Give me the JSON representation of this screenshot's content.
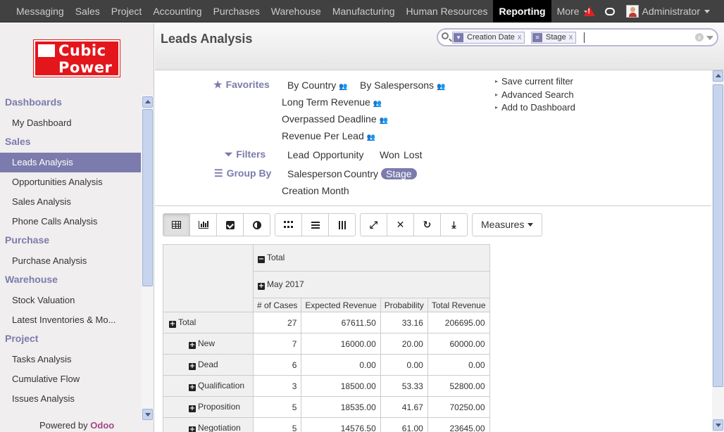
{
  "topbar": {
    "menu": [
      "Messaging",
      "Sales",
      "Project",
      "Accounting",
      "Purchases",
      "Warehouse",
      "Manufacturing",
      "Human Resources",
      "Reporting",
      "More"
    ],
    "active": "Reporting",
    "user": "Administrator"
  },
  "logo": {
    "line1": "Cubic",
    "line2": "Power"
  },
  "sidebar": {
    "sections": [
      {
        "title": "Dashboards",
        "items": [
          "My Dashboard"
        ]
      },
      {
        "title": "Sales",
        "items": [
          "Leads Analysis",
          "Opportunities Analysis",
          "Sales Analysis",
          "Phone Calls Analysis"
        ]
      },
      {
        "title": "Purchase",
        "items": [
          "Purchase Analysis"
        ]
      },
      {
        "title": "Warehouse",
        "items": [
          "Stock Valuation",
          "Latest Inventories & Mo..."
        ]
      },
      {
        "title": "Project",
        "items": [
          "Tasks Analysis",
          "Cumulative Flow",
          "Issues Analysis"
        ]
      }
    ],
    "active_item": "Leads Analysis",
    "powered_by": "Powered by",
    "powered_brand": "Odoo"
  },
  "header": {
    "title": "Leads Analysis"
  },
  "search": {
    "facets": [
      {
        "icon": "filter-icon",
        "label": "Creation Date"
      },
      {
        "icon": "group-icon",
        "label": "Stage"
      }
    ],
    "remove": "x",
    "clear": "x"
  },
  "drawer": {
    "favorites_label": "Favorites",
    "favorites": [
      "By Country",
      "By Salespersons",
      "Long Term Revenue",
      "Overpassed Deadline",
      "Revenue Per Lead"
    ],
    "filters_label": "Filters",
    "filters": [
      "Lead",
      "Opportunity",
      "Won",
      "Lost"
    ],
    "groupby_label": "Group By",
    "groupby": [
      "Salesperson",
      "Country",
      "Stage",
      "Creation Month"
    ],
    "groupby_active": "Stage",
    "actions": [
      "Save current filter",
      "Advanced Search",
      "Add to Dashboard"
    ]
  },
  "toolbar": {
    "measures": "Measures"
  },
  "pivot": {
    "col_total": "Total",
    "col_group": "May 2017",
    "measures": [
      "# of Cases",
      "Expected Revenue",
      "Probability",
      "Total Revenue"
    ],
    "rows": [
      {
        "label": "Total",
        "values": [
          "27",
          "67611.50",
          "33.16",
          "206695.00"
        ]
      },
      {
        "label": "New",
        "values": [
          "7",
          "16000.00",
          "20.00",
          "60000.00"
        ]
      },
      {
        "label": "Dead",
        "values": [
          "6",
          "0.00",
          "0.00",
          "0.00"
        ]
      },
      {
        "label": "Qualification",
        "values": [
          "3",
          "18500.00",
          "53.33",
          "52800.00"
        ]
      },
      {
        "label": "Proposition",
        "values": [
          "5",
          "18535.00",
          "41.67",
          "70250.00"
        ]
      },
      {
        "label": "Negotiation",
        "values": [
          "5",
          "14576.50",
          "61.00",
          "23645.00"
        ]
      }
    ]
  }
}
